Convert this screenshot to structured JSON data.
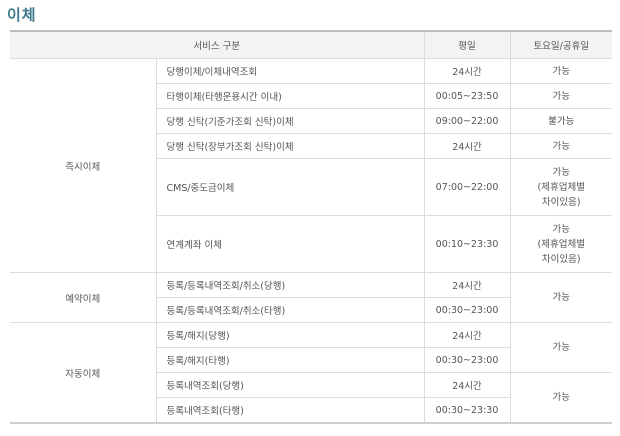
{
  "page_title": "이체",
  "table": {
    "headers": {
      "service": "서비스 구분",
      "weekday": "평일",
      "weekend": "토요일/공휴일"
    },
    "groups": [
      {
        "name": "즉시이체",
        "rows": [
          {
            "service": "당행이체/이체내역조회",
            "weekday": "24시간",
            "weekend": [
              "가능"
            ]
          },
          {
            "service": "타행이체(타행운용시간 이내)",
            "weekday": "00:05~23:50",
            "weekend": [
              "가능"
            ]
          },
          {
            "service": "당행 신탁(기준가조회 신탁)이체",
            "weekday": "09:00~22:00",
            "weekend": [
              "불가능"
            ]
          },
          {
            "service": "당행 신탁(장부가조회 신탁)이체",
            "weekday": "24시간",
            "weekend": [
              "가능"
            ]
          },
          {
            "service": "CMS/중도금이체",
            "weekday": "07:00~22:00",
            "weekend": [
              "가능",
              "(제휴업체별",
              "차이있음)"
            ]
          },
          {
            "service": "연계계좌 이체",
            "weekday": "00:10~23:30",
            "weekend": [
              "가능",
              "(제휴업체별",
              "차이있음)"
            ]
          }
        ]
      },
      {
        "name": "예약이체",
        "weekend_merged": "가능",
        "rows": [
          {
            "service": "등록/등록내역조회/취소(당행)",
            "weekday": "24시간"
          },
          {
            "service": "등록/등록내역조회/취소(타행)",
            "weekday": "00:30~23:00"
          }
        ]
      },
      {
        "name": "자동이체",
        "weekend_merged": [
          "가능",
          "가능"
        ],
        "rows": [
          {
            "service": "등록/해지(당행)",
            "weekday": "24시간"
          },
          {
            "service": "등록/해지(타행)",
            "weekday": "00:30~23:00"
          },
          {
            "service": "등록내역조회(당행)",
            "weekday": "24시간"
          },
          {
            "service": "등록내역조회(타행)",
            "weekday": "00:30~23:30"
          }
        ]
      }
    ]
  }
}
